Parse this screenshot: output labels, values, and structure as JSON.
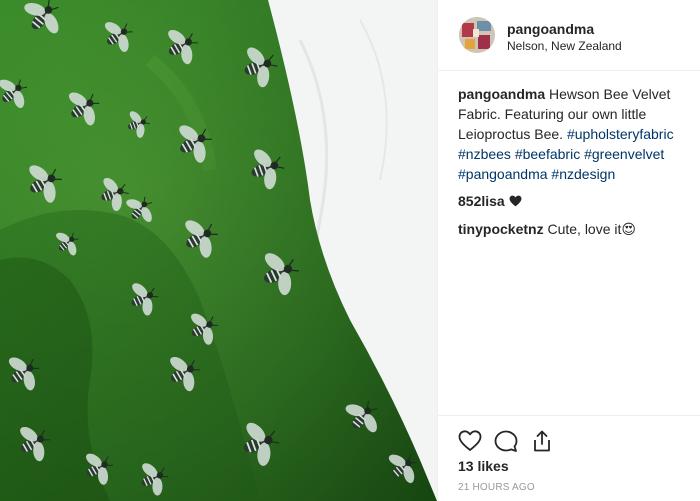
{
  "post": {
    "username": "pangoandma",
    "location": "Nelson, New Zealand",
    "caption": {
      "username": "pangoandma",
      "text": "Hewson Bee Velvet Fabric. Featuring our own little Leioproctus Bee.",
      "hashtags": [
        "#upholsteryfabric",
        "#nzbees",
        "#beefabric",
        "#greenvelvet",
        "#pangoandma",
        "#nzdesign"
      ]
    },
    "comments": [
      {
        "username": "852lisa",
        "text": "",
        "emoji": "heart-icon"
      },
      {
        "username": "tinypocketnz",
        "text": "Cute, love it😍"
      }
    ],
    "likes": "13 likes",
    "timestamp": "21 HOURS AGO"
  },
  "icons": {
    "like": "heart-outline-icon",
    "comment": "comment-bubble-icon",
    "share": "share-icon"
  },
  "colors": {
    "hashtag": "#003569",
    "fabric_green": "#3b8a2a",
    "border": "#efefef",
    "timestamp": "#999999"
  }
}
